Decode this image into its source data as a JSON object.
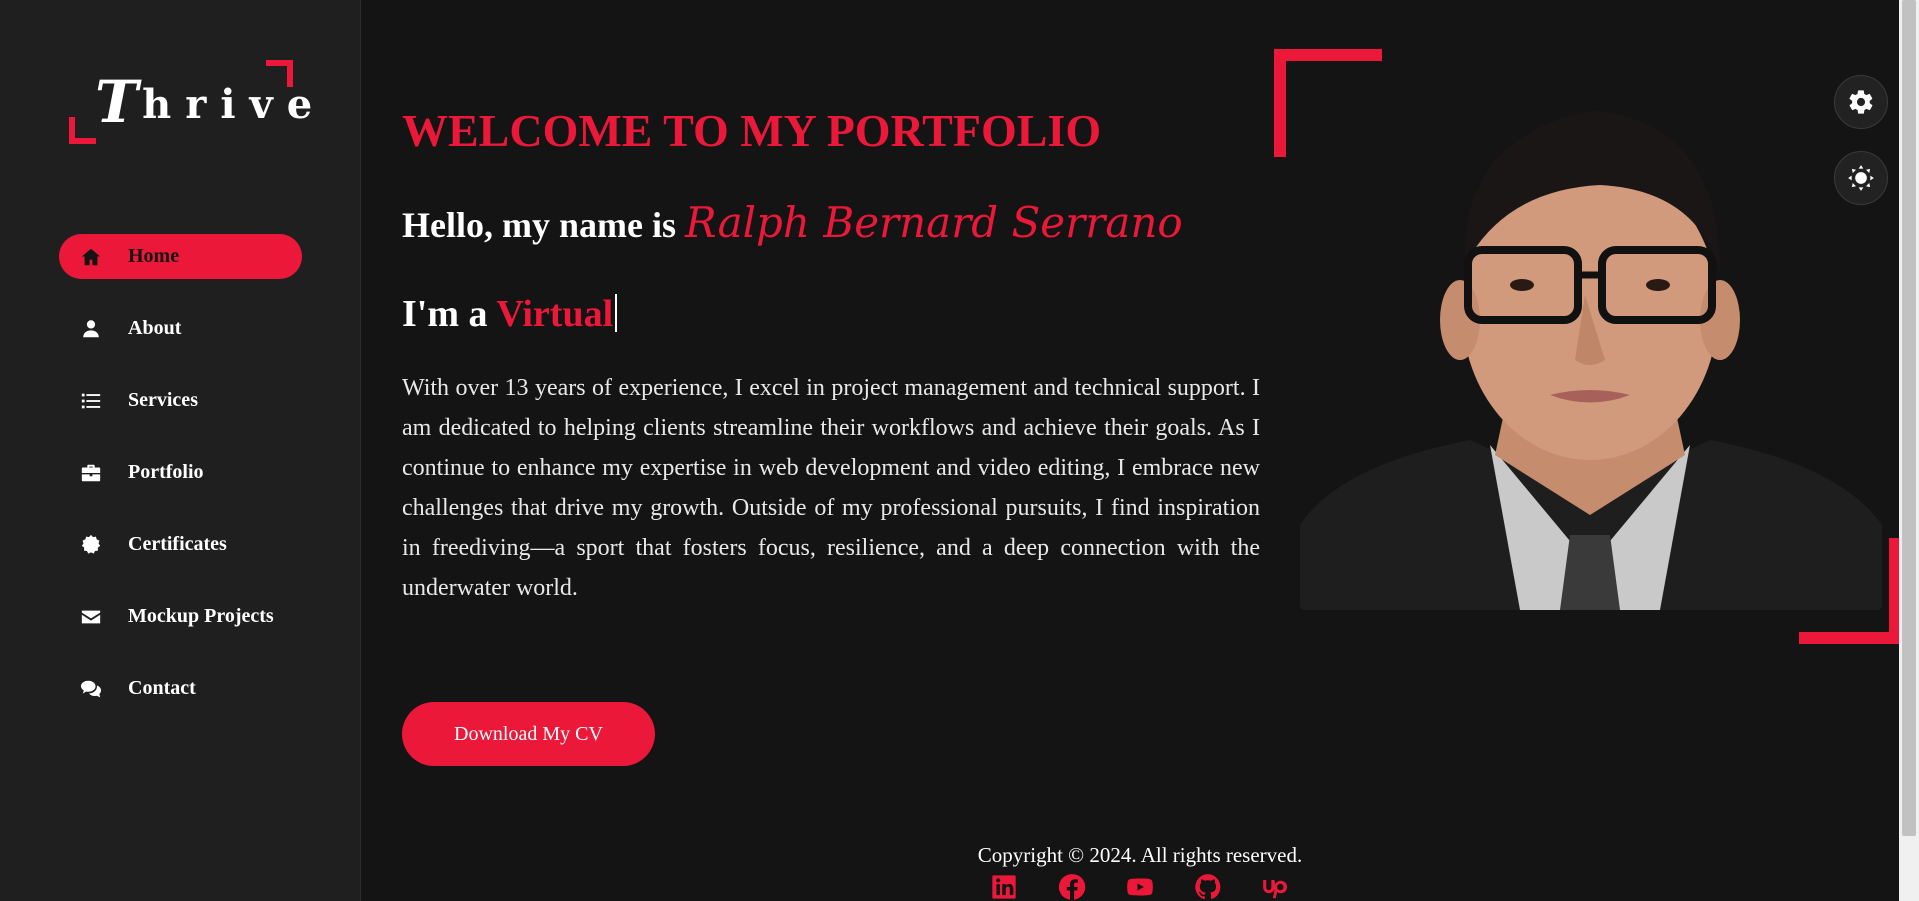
{
  "brand": {
    "logo_first": "T",
    "logo_rest": "hrive",
    "accent": "#ec1839"
  },
  "sidebar": {
    "items": [
      {
        "label": "Home",
        "icon": "home-icon",
        "active": true
      },
      {
        "label": "About",
        "icon": "user-icon"
      },
      {
        "label": "Services",
        "icon": "list-icon"
      },
      {
        "label": "Portfolio",
        "icon": "briefcase-icon"
      },
      {
        "label": "Certificates",
        "icon": "certificate-icon"
      },
      {
        "label": "Mockup Projects",
        "icon": "envelope-icon"
      },
      {
        "label": "Contact",
        "icon": "comments-icon"
      }
    ]
  },
  "hero": {
    "headline": "WELCOME TO MY PORTFOLIO",
    "greeting_prefix": "Hello, my name is ",
    "name": "Ralph Bernard Serrano",
    "role_prefix": "I'm a ",
    "role_typed": "Virtual",
    "bio": "With over 13 years of experience, I excel in project management and technical support. I am dedicated to helping clients streamline their workflows and achieve their goals. As I continue to enhance my expertise in web development and video editing, I embrace new challenges that drive my growth. Outside of my professional pursuits, I find inspiration in freediving—a sport that fosters focus, resilience, and a deep connection with the underwater world.",
    "cv_button": "Download My CV"
  },
  "floating": {
    "settings_icon": "gear-icon",
    "theme_icon": "sun-icon"
  },
  "footer": {
    "copyright": "Copyright © 2024. All rights reserved.",
    "socials": [
      "linkedin-icon",
      "facebook-icon",
      "youtube-icon",
      "github-icon",
      "upwork-icon"
    ]
  }
}
